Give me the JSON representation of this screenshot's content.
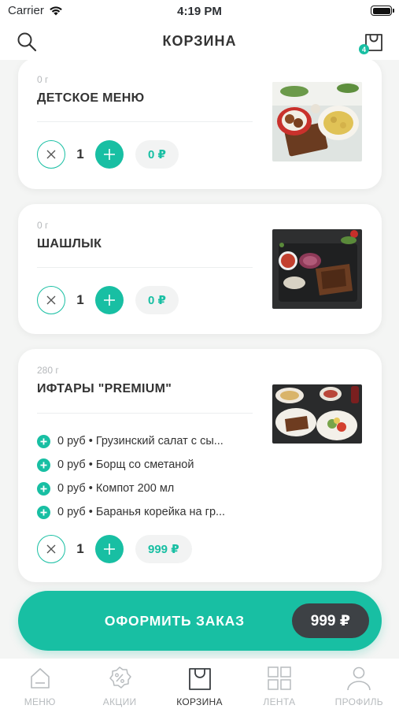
{
  "status_bar": {
    "carrier": "Carrier",
    "time": "4:19 PM"
  },
  "header": {
    "title": "КОРЗИНА",
    "cart_badge": "4"
  },
  "items": [
    {
      "weight": "0 г",
      "name": "ДЕТСКОЕ МЕНЮ",
      "quantity": "1",
      "price": "0 ₽"
    },
    {
      "weight": "0 г",
      "name": "ШАШЛЫК",
      "quantity": "1",
      "price": "0 ₽"
    },
    {
      "weight": "280 г",
      "name": "ИФТАРЫ \"PREMIUM\"",
      "quantity": "1",
      "price": "999 ₽",
      "options": [
        "0 руб • Грузинский салат с сы...",
        "0 руб • Борщ со сметаной",
        "0 руб • Компот 200 мл",
        "0 руб • Баранья корейка на гр..."
      ]
    }
  ],
  "checkout": {
    "label": "ОФОРМИТЬ ЗАКАЗ",
    "total": "999 ₽"
  },
  "tabs": [
    {
      "label": "МЕНЮ",
      "icon": "menu-home-icon"
    },
    {
      "label": "АКЦИИ",
      "icon": "percent-badge-icon"
    },
    {
      "label": "КОРЗИНА",
      "icon": "shopping-bag-icon"
    },
    {
      "label": "ЛЕНТА",
      "icon": "grid-icon"
    },
    {
      "label": "ПРОФИЛЬ",
      "icon": "user-icon"
    }
  ],
  "colors": {
    "accent": "#18bfa3",
    "dark_pill": "#3d4145",
    "muted": "#b7bbbe"
  }
}
